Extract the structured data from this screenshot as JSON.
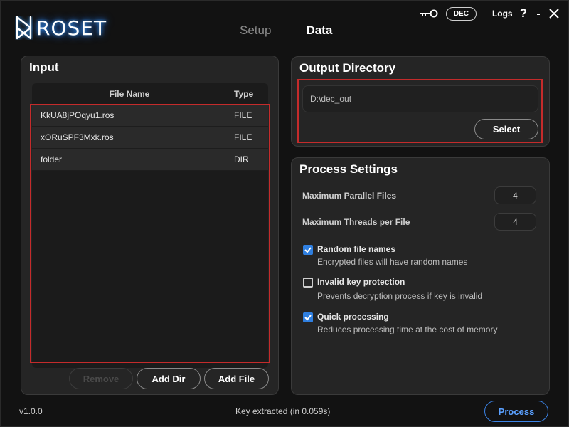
{
  "app": {
    "name": "ROSET",
    "version": "v1.0.0",
    "status": "Key extracted (in 0.059s)",
    "accent_color": "#2f7fe0",
    "highlight_color": "#c42b2b"
  },
  "header": {
    "tabs": [
      {
        "label": "Setup",
        "active": false
      },
      {
        "label": "Data",
        "active": true
      }
    ],
    "key_icon": "key-icon",
    "mode_label": "DEC",
    "logs_label": "Logs",
    "help_label": "?"
  },
  "input_panel": {
    "title": "Input",
    "columns": [
      "File Name",
      "Type"
    ],
    "rows": [
      {
        "name": "KkUA8jPOqyu1.ros",
        "type": "FILE"
      },
      {
        "name": "xORuSPF3Mxk.ros",
        "type": "FILE"
      },
      {
        "name": "folder",
        "type": "DIR"
      }
    ],
    "buttons": {
      "remove": "Remove",
      "add_dir": "Add Dir",
      "add_file": "Add File"
    }
  },
  "output_panel": {
    "title": "Output Directory",
    "path": "D:\\dec_out",
    "select_label": "Select"
  },
  "settings_panel": {
    "title": "Process Settings",
    "max_parallel_label": "Maximum Parallel Files",
    "max_parallel_value": "4",
    "max_threads_label": "Maximum Threads per File",
    "max_threads_value": "4",
    "options": [
      {
        "title": "Random file names",
        "desc": "Encrypted files will have random names",
        "checked": true
      },
      {
        "title": "Invalid key protection",
        "desc": "Prevents decryption process if key is invalid",
        "checked": false
      },
      {
        "title": "Quick processing",
        "desc": "Reduces processing time at the cost of memory",
        "checked": true
      }
    ]
  },
  "footer": {
    "process_label": "Process"
  }
}
